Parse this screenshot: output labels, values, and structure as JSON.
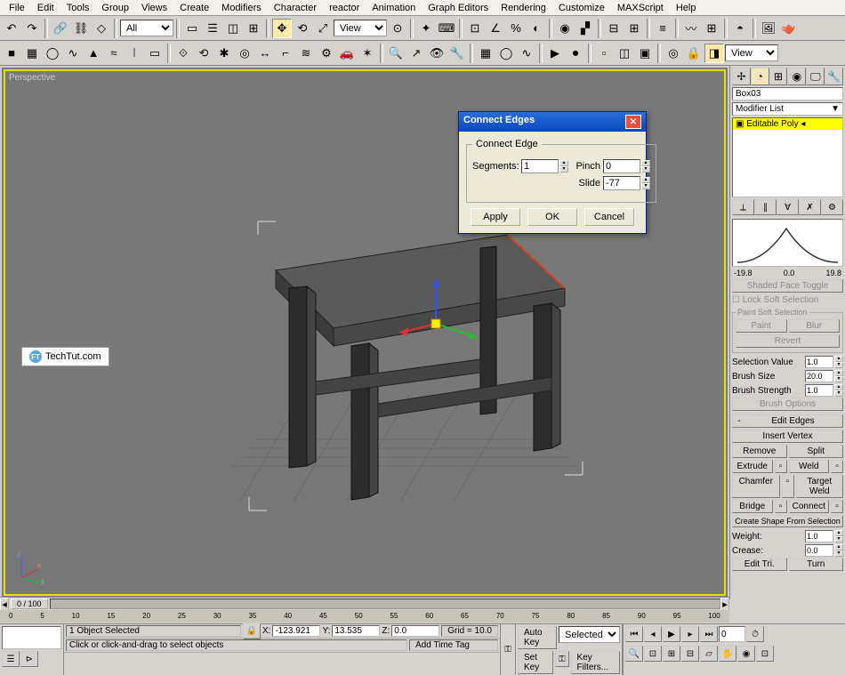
{
  "menu": [
    "File",
    "Edit",
    "Tools",
    "Group",
    "Views",
    "Create",
    "Modifiers",
    "Character",
    "reactor",
    "Animation",
    "Graph Editors",
    "Rendering",
    "Customize",
    "MAXScript",
    "Help"
  ],
  "toolbar1": {
    "all": "All",
    "view": "View"
  },
  "toolbar2": {
    "view": "View"
  },
  "viewport": {
    "label": "Perspective"
  },
  "watermark": {
    "text": "TechTut.com",
    "badge": "FT"
  },
  "timeline": {
    "pos": "0 / 100",
    "ticks": [
      "0",
      "5",
      "10",
      "15",
      "20",
      "25",
      "30",
      "35",
      "40",
      "45",
      "50",
      "55",
      "60",
      "65",
      "70",
      "75",
      "80",
      "85",
      "90",
      "95",
      "100"
    ]
  },
  "dialog": {
    "title": "Connect Edges",
    "group": "Connect Edge",
    "segments_label": "Segments:",
    "segments": "1",
    "pinch_label": "Pinch",
    "pinch": "0",
    "slide_label": "Slide",
    "slide": "-77",
    "apply": "Apply",
    "ok": "OK",
    "cancel": "Cancel"
  },
  "panel": {
    "object": "Box03",
    "modlist": "Modifier List",
    "stack_item": "Editable Poly",
    "curve_nums": [
      "-19.8",
      "0.0",
      "19.8"
    ],
    "shaded": "Shaded Face Toggle",
    "lock": "Lock Soft Selection",
    "paint_group": "Paint Soft Selection",
    "paint": "Paint",
    "blur": "Blur",
    "revert": "Revert",
    "selval": "Selection Value",
    "selval_v": "1.0",
    "brushsize": "Brush Size",
    "brushsize_v": "20.0",
    "brushstr": "Brush Strength",
    "brushstr_v": "1.0",
    "brushopt": "Brush Options",
    "edit_edges": "Edit Edges",
    "insert_vertex": "Insert Vertex",
    "remove": "Remove",
    "split": "Split",
    "extrude": "Extrude",
    "weld": "Weld",
    "chamfer": "Chamfer",
    "target": "Target Weld",
    "bridge": "Bridge",
    "connect": "Connect",
    "create_shape": "Create Shape From Selection",
    "weight": "Weight:",
    "weight_v": "1.0",
    "crease": "Crease:",
    "crease_v": "0.0",
    "edit_tri": "Edit Tri.",
    "turn": "Turn"
  },
  "status": {
    "selected": "1 Object Selected",
    "hint": "Click or click-and-drag to select objects",
    "x": "-123.921",
    "y": "13.535",
    "z": "0.0",
    "grid": "Grid = 10.0",
    "add_tag": "Add Time Tag",
    "autokey": "Auto Key",
    "setkey": "Set Key",
    "sel": "Selected",
    "keyfilt": "Key Filters..."
  }
}
